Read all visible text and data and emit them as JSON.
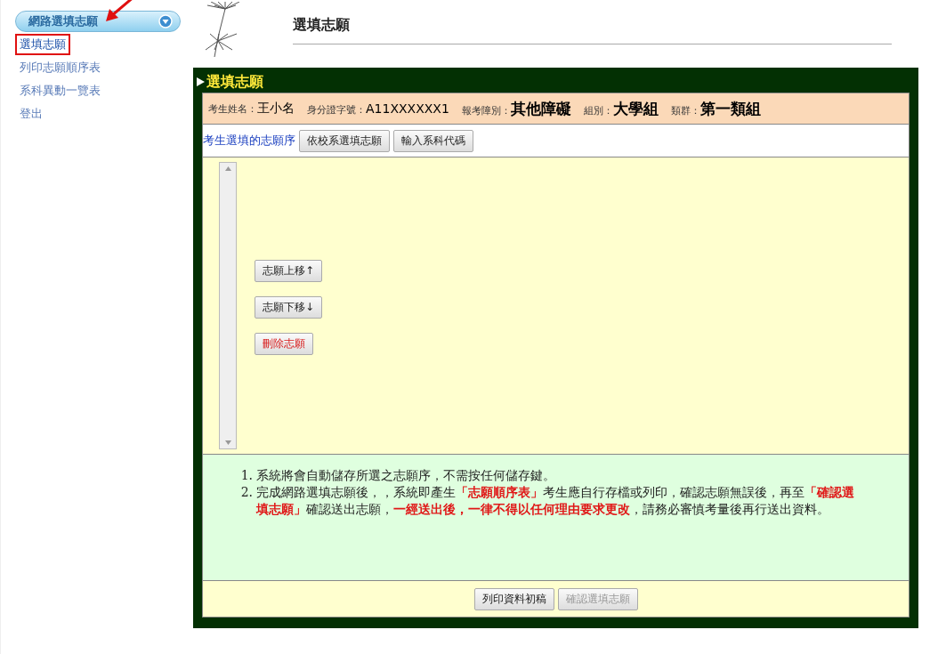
{
  "sidebar": {
    "header": "網路選填志願",
    "items": [
      {
        "label": "選填志願",
        "selected": true
      },
      {
        "label": "列印志願順序表",
        "selected": false
      },
      {
        "label": "系科異動一覽表",
        "selected": false
      },
      {
        "label": "登出",
        "selected": false
      }
    ]
  },
  "page_title": "選填志願",
  "panel": {
    "title": "選填志願",
    "info": [
      {
        "label": "考生姓名：",
        "value": "王小名",
        "kind": "plain"
      },
      {
        "label": "身分證字號：",
        "value": "A11XXXXXX1",
        "kind": "plain"
      },
      {
        "label": "報考障別：",
        "value": "其他障礙",
        "kind": "bold"
      },
      {
        "label": "組別：",
        "value": "大學組",
        "kind": "bold"
      },
      {
        "label": "類群：",
        "value": "第一類組",
        "kind": "bold"
      }
    ],
    "toolbar": {
      "label": "考生選填的志願序",
      "buttons": [
        "依校系選填志願",
        "輸入系科代碼"
      ]
    },
    "list_buttons": [
      {
        "label": "志願上移↑",
        "kind": "normal"
      },
      {
        "label": "志願下移↓",
        "kind": "normal"
      },
      {
        "label": "刪除志願",
        "kind": "danger"
      }
    ],
    "notes": [
      {
        "marker": "1.",
        "text": "系統將會自動儲存所選之志願序，不需按任何儲存鍵。"
      },
      {
        "marker": "2.",
        "text": "完成網路選填志願後，，系統即產生**「志願順序表」**考生應自行存檔或列印，確認志願無誤後，再至**「確認選填志願」**確認送出志願，**一經送出後，一律不得以任何理由要求更改**，請務必審慎考量後再行送出資料。"
      }
    ],
    "footer_buttons": [
      {
        "label": "列印資料初稿",
        "disabled": false
      },
      {
        "label": "確認選填志願",
        "disabled": true
      }
    ]
  }
}
